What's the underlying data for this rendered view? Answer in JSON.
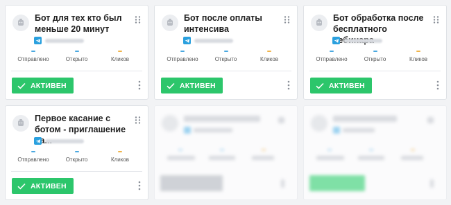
{
  "cards": [
    {
      "title": "Бот для тех кто был меньше 20 минут",
      "stats": {
        "sent": "Отправлено",
        "opened": "Открыто",
        "clicks": "Кликов"
      },
      "status": "АКТИВЕН"
    },
    {
      "title": "Бот после оплаты интенсива",
      "stats": {
        "sent": "Отправлено",
        "opened": "Открыто",
        "clicks": "Кликов"
      },
      "status": "АКТИВЕН"
    },
    {
      "title": "Бот обработка после бесплатного вебинара",
      "stats": {
        "sent": "Отправлено",
        "opened": "Открыто",
        "clicks": "Кликов"
      },
      "status": "АКТИВЕН"
    },
    {
      "title": "Первое касание с ботом - приглашение на...",
      "stats": {
        "sent": "Отправлено",
        "opened": "Открыто",
        "clicks": "Кликов"
      },
      "status": "АКТИВЕН"
    }
  ],
  "colors": {
    "active_green": "#2cc66b",
    "sent_mark": "#4aa8e0",
    "opened_mark": "#4aa8e0",
    "clicks_mark": "#f0b44a",
    "telegram_blue": "#2aa0de"
  },
  "icons": {
    "avatar": "bot-icon",
    "drag": "drag-handle-icon",
    "messenger": "telegram-icon",
    "status": "check-icon",
    "menu": "more-vertical-icon"
  }
}
